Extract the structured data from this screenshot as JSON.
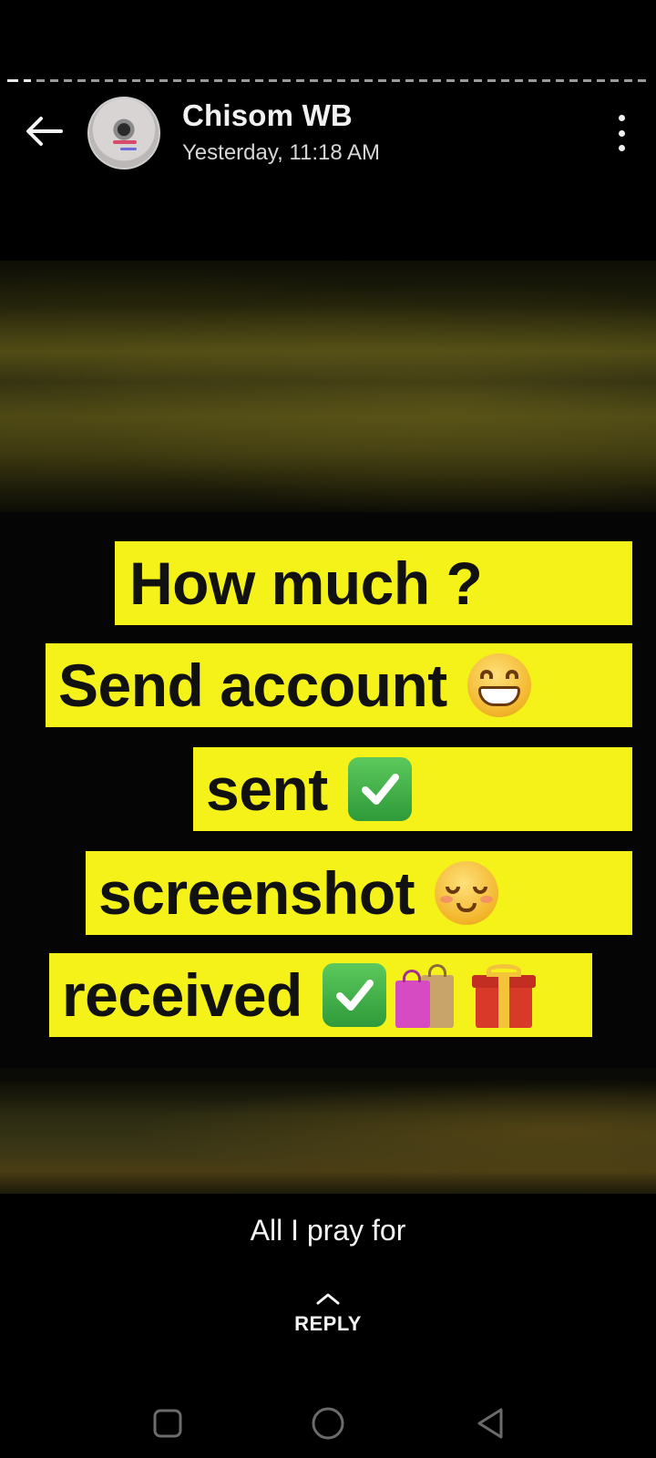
{
  "app": {
    "screen": "status-viewer"
  },
  "header": {
    "contact_name": "Chisom WB",
    "timestamp": "Yesterday, 11:18 AM",
    "back_icon": "arrow-left-icon",
    "menu_icon": "more-vertical-icon"
  },
  "progress": {
    "total_segments": 2,
    "viewed_segments": 2
  },
  "status_image": {
    "lines": [
      {
        "text": "How much ?",
        "emoji": []
      },
      {
        "text": "Send account",
        "emoji": [
          "grinning-face-icon"
        ]
      },
      {
        "text": "sent",
        "emoji": [
          "check-mark-button-icon"
        ]
      },
      {
        "text": "screenshot",
        "emoji": [
          "relieved-face-icon"
        ]
      },
      {
        "text": "received",
        "emoji": [
          "check-mark-button-icon",
          "shopping-bags-icon",
          "gift-icon"
        ]
      }
    ]
  },
  "caption": "All I pray for",
  "reply": {
    "label": "REPLY",
    "icon": "chevron-up-icon"
  },
  "navbar": {
    "buttons": [
      "recent-apps-icon",
      "home-icon",
      "back-triangle-icon"
    ]
  },
  "colors": {
    "background": "#000000",
    "bubble": "#f5f21a",
    "bubble_text": "#111111",
    "check_green": "#2e9a3a"
  }
}
